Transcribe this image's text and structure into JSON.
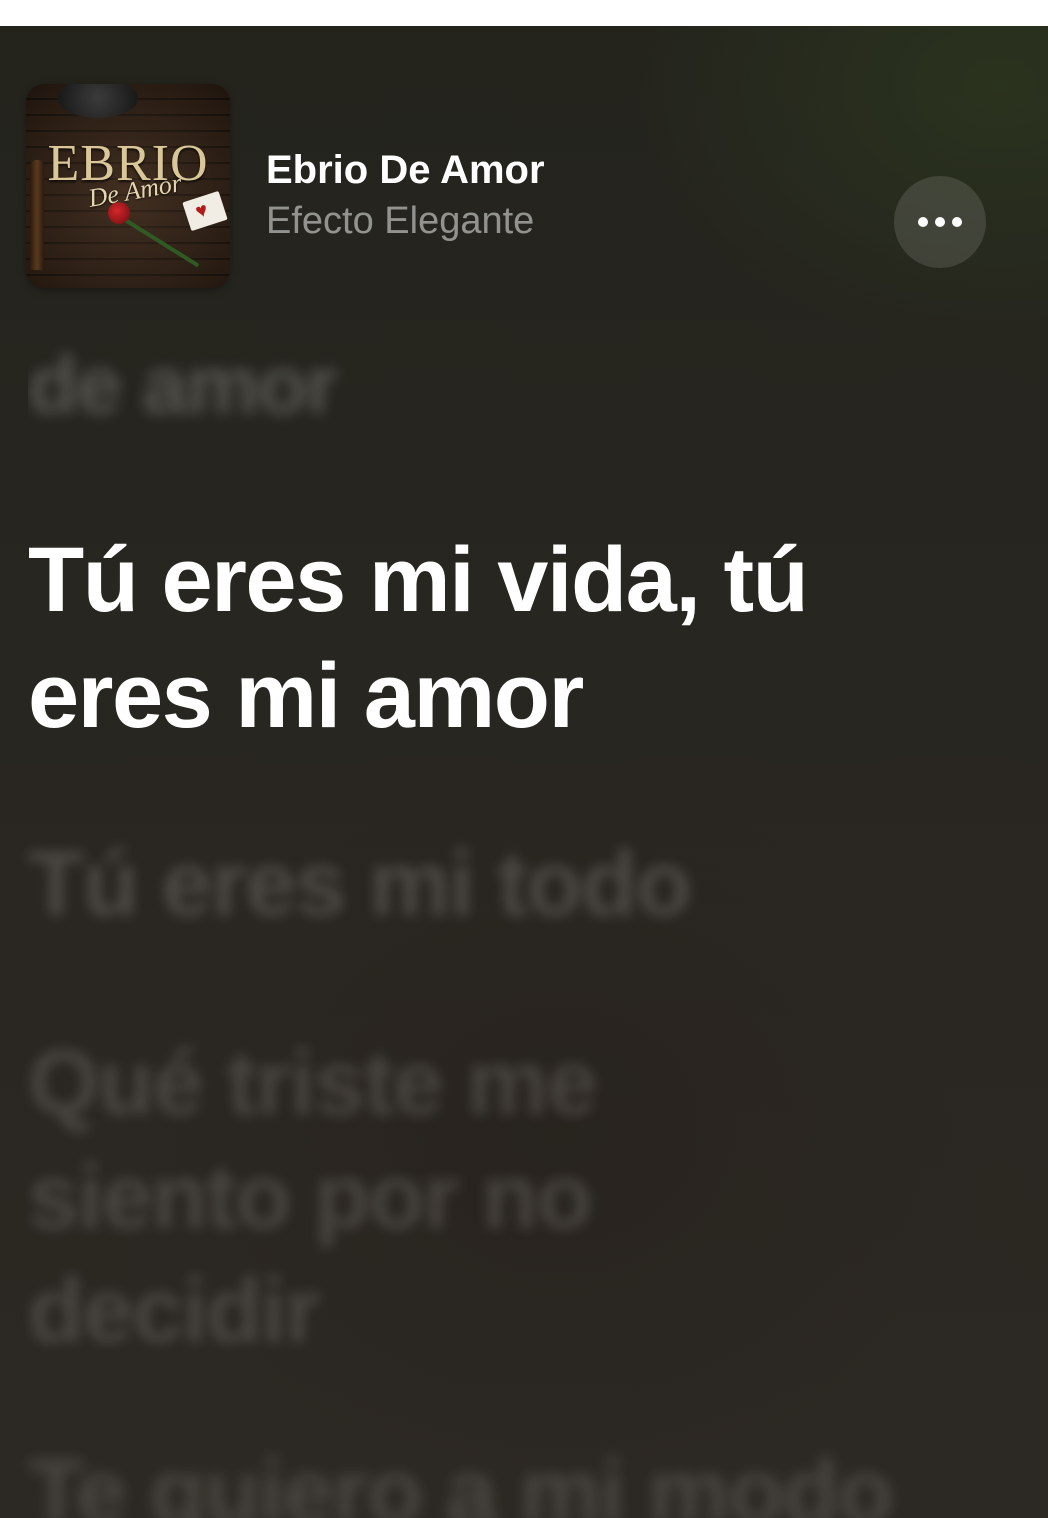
{
  "now_playing": {
    "title": "Ebrio De Amor",
    "artist": "Efecto Elegante",
    "artwork": {
      "title_text": "EBRIO",
      "subtitle_text": "De Amor"
    },
    "more_icon": "ellipsis-icon"
  },
  "lyrics": {
    "previous": "de amor",
    "active": "Tú eres mi vida, tú eres mi amor",
    "next": [
      "Tú eres mi todo",
      "Qué triste me siento por no decidir",
      "Te quiero a mi modo"
    ]
  }
}
